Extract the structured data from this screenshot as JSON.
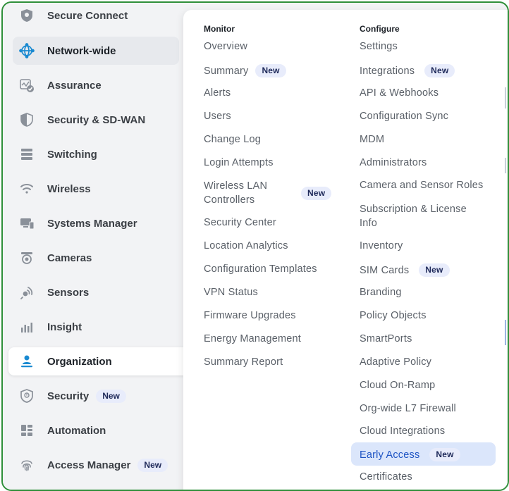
{
  "colors": {
    "frame": "#2f8f3a",
    "accent": "#1e54c4",
    "badge_bg": "#e8ecfb",
    "active_icon": "#1a8ad1"
  },
  "sidebar": {
    "items": [
      {
        "label": "Secure Connect",
        "icon": "shield-lock-icon"
      },
      {
        "label": "Network-wide",
        "icon": "globe-network-icon"
      },
      {
        "label": "Assurance",
        "icon": "assurance-check-icon"
      },
      {
        "label": "Security & SD-WAN",
        "icon": "half-shield-icon"
      },
      {
        "label": "Switching",
        "icon": "switch-stack-icon"
      },
      {
        "label": "Wireless",
        "icon": "wifi-icon"
      },
      {
        "label": "Systems Manager",
        "icon": "devices-icon"
      },
      {
        "label": "Cameras",
        "icon": "camera-icon"
      },
      {
        "label": "Sensors",
        "icon": "sensor-signal-icon"
      },
      {
        "label": "Insight",
        "icon": "bar-chart-icon"
      },
      {
        "label": "Organization",
        "icon": "org-person-icon"
      },
      {
        "label": "Security",
        "icon": "shield-alert-icon",
        "badge": "New"
      },
      {
        "label": "Automation",
        "icon": "automation-grid-icon"
      },
      {
        "label": "Access Manager",
        "icon": "fingerprint-icon",
        "badge": "New"
      }
    ]
  },
  "menu": {
    "monitor": {
      "heading": "Monitor",
      "items": [
        {
          "label": "Overview"
        },
        {
          "label": "Summary",
          "badge": "New"
        },
        {
          "label": "Alerts"
        },
        {
          "label": "Users"
        },
        {
          "label": "Change Log"
        },
        {
          "label": "Login Attempts"
        },
        {
          "label": "Wireless LAN Controllers",
          "badge": "New"
        },
        {
          "label": "Security Center"
        },
        {
          "label": "Location Analytics"
        },
        {
          "label": "Configuration Templates"
        },
        {
          "label": "VPN Status"
        },
        {
          "label": "Firmware Upgrades"
        },
        {
          "label": "Energy Management"
        },
        {
          "label": "Summary Report"
        }
      ]
    },
    "configure": {
      "heading": "Configure",
      "items": [
        {
          "label": "Settings"
        },
        {
          "label": "Integrations",
          "badge": "New"
        },
        {
          "label": "API & Webhooks"
        },
        {
          "label": "Configuration Sync"
        },
        {
          "label": "MDM"
        },
        {
          "label": "Administrators"
        },
        {
          "label": "Camera and Sensor Roles"
        },
        {
          "label": "Subscription & License Info"
        },
        {
          "label": "Inventory"
        },
        {
          "label": "SIM Cards",
          "badge": "New"
        },
        {
          "label": "Branding"
        },
        {
          "label": "Policy Objects"
        },
        {
          "label": "SmartPorts"
        },
        {
          "label": "Adaptive Policy"
        },
        {
          "label": "Cloud On-Ramp"
        },
        {
          "label": "Org-wide L7 Firewall"
        },
        {
          "label": "Cloud Integrations"
        },
        {
          "label": "Early Access",
          "badge": "New"
        },
        {
          "label": "Certificates"
        }
      ]
    }
  }
}
